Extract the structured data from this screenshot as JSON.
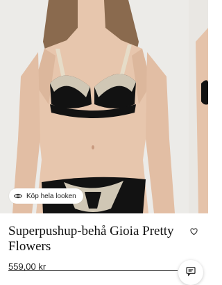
{
  "product": {
    "title": "Superpushup-behå Gioia Pretty Flowers",
    "price": "559,00 kr"
  },
  "gallery": {
    "shop_look_label": "Köp hela looken"
  },
  "icons": {
    "shop_look": "eye-icon",
    "wishlist": "heart-icon",
    "chat": "chat-icon"
  },
  "colors": {
    "text": "#111111",
    "garment": "#121212",
    "lace": "#e6dcc8",
    "image_background": "#ecebe8"
  }
}
